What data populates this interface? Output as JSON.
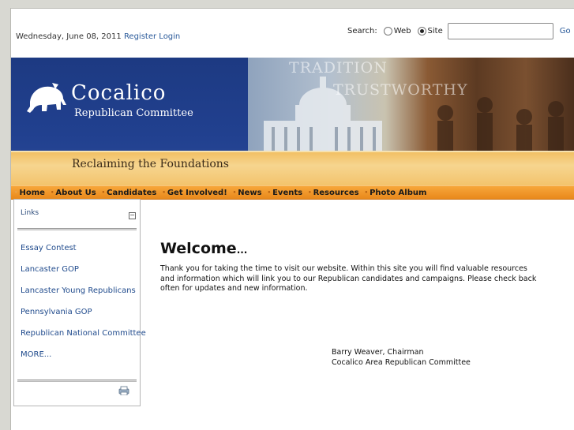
{
  "topbar": {
    "date": "Wednesday, June 08, 2011",
    "register": "Register",
    "login": "Login"
  },
  "search": {
    "label": "Search:",
    "web_label": "Web",
    "site_label": "Site",
    "selected": "Site",
    "query": "",
    "go_label": "Go"
  },
  "banner": {
    "title": "Cocalico",
    "subtitle": "Republican Committee",
    "tagline": "Reclaiming the Foundations",
    "word1": "TRADITION",
    "word2": "TRUSTWORTHY"
  },
  "nav": {
    "items": [
      "Home",
      "About Us",
      "Candidates",
      "Get Involved!",
      "News",
      "Events",
      "Resources",
      "Photo Album"
    ]
  },
  "links": {
    "title": "Links",
    "collapse": "−",
    "items": [
      "Essay Contest",
      "Lancaster GOP",
      "Lancaster Young Republicans",
      "Pennsylvania GOP",
      "Republican National Committee",
      "MORE..."
    ]
  },
  "main": {
    "heading": "Welcome",
    "heading_suffix": "...",
    "body": "Thank you for taking the time to visit our website. Within this site you will find valuable resources and information which will link you to our Republican candidates and campaigns. Please check back often for updates and new information.",
    "signature_name": "Barry Weaver, Chairman",
    "signature_org": "Cocalico Area Republican Committee"
  },
  "colors": {
    "banner_blue": "#21408f",
    "banner_orange": "#f3c36c",
    "nav_orange": "#e9891c",
    "link_blue": "#1f4a8c"
  }
}
